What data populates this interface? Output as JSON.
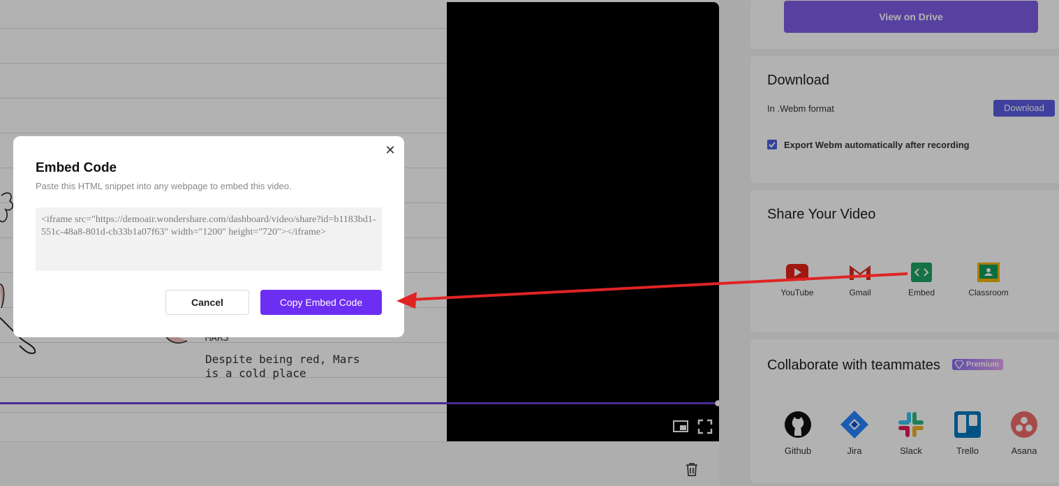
{
  "video": {
    "caption_title": "MARS",
    "caption_line1": "Despite being red, Mars",
    "caption_line2": "is a cold place",
    "progress_color": "#6b3fd4",
    "controls": [
      "picture-in-picture-icon",
      "fullscreen-icon"
    ],
    "delete_icon": "trash-icon"
  },
  "right_panel": {
    "drive_button": "View on Drive",
    "download": {
      "title": "Download",
      "format_text": "In .Webm format",
      "button": "Download",
      "checkbox_label": "Export Webm automatically after recording",
      "checkbox_checked": true
    },
    "share": {
      "title": "Share Your Video",
      "items": [
        {
          "label": "YouTube",
          "icon": "youtube-icon"
        },
        {
          "label": "Gmail",
          "icon": "gmail-icon"
        },
        {
          "label": "Embed",
          "icon": "embed-icon"
        },
        {
          "label": "Classroom",
          "icon": "classroom-icon"
        }
      ]
    },
    "collaborate": {
      "title": "Collaborate with teammates",
      "badge": "Premium",
      "items": [
        {
          "label": "Github",
          "icon": "github-icon"
        },
        {
          "label": "Jira",
          "icon": "jira-icon"
        },
        {
          "label": "Slack",
          "icon": "slack-icon"
        },
        {
          "label": "Trello",
          "icon": "trello-icon"
        },
        {
          "label": "Asana",
          "icon": "asana-icon"
        }
      ]
    }
  },
  "modal": {
    "title": "Embed Code",
    "subtitle": "Paste this HTML snippet into any webpage to embed this video.",
    "code": "<iframe src=\"https://demoair.wondershare.com/dashboard/video/share?id=b1183bd1-551c-48a8-801d-cb33b1a07f63\" width=\"1200\" height=\"720\"></iframe>",
    "cancel_label": "Cancel",
    "copy_label": "Copy Embed Code"
  },
  "colors": {
    "accent_purple": "#6d2ef3",
    "drive_button": "#7d5ee6",
    "download_button": "#5b5ce2",
    "annotation_arrow": "#e02424"
  }
}
